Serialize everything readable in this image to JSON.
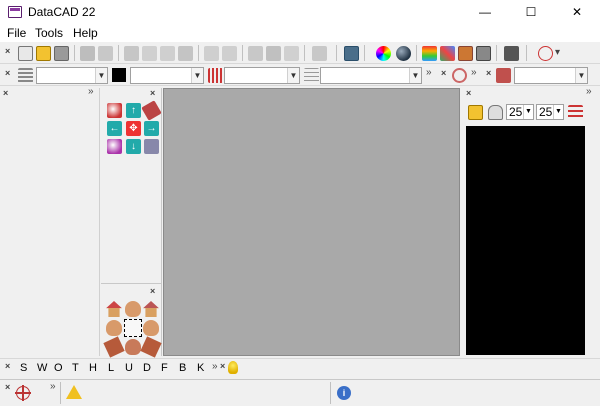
{
  "window": {
    "title": "DataCAD 22",
    "minimize_glyph": "—",
    "maximize_glyph": "☐",
    "close_glyph": "✕"
  },
  "menu": {
    "items": [
      "File",
      "Tools",
      "Help"
    ]
  },
  "toolbars": {
    "close_glyph": "×",
    "overflow_glyph": "»",
    "main_icons": [
      "new-file-icon",
      "open-folder-icon",
      "save-icon",
      "print-icon",
      "print-preview-icon",
      "paste-special-icon",
      "cut-icon",
      "copy-icon",
      "paste-icon",
      "undo-icon",
      "redo-icon",
      "layer-icon",
      "layer-set-icon",
      "snap-icon",
      "rotate-icon",
      "stack-icon",
      "color-wheel-icon",
      "sphere-icon",
      "rainbow-icon",
      "palette-icon",
      "hatch-icon",
      "fill-icon",
      "settings-icon",
      "symbol-icon"
    ],
    "layer_combo_value": "",
    "color_swatch": "#000000",
    "linetype_combo_value": "",
    "pattern_combo_value": "",
    "weight_combo_value": "",
    "material_combo_value": ""
  },
  "right_panel": {
    "spin1_value": "25",
    "spin2_value": "25"
  },
  "snap_bar": {
    "keys": [
      "S",
      "W",
      "O",
      "T",
      "H",
      "L",
      "U",
      "D",
      "F",
      "B",
      "K"
    ]
  },
  "status_bar": {
    "message": ""
  },
  "colors": {
    "drawing_area": "#a9a9a9",
    "preview_background": "#000000",
    "app_icon": "#8a3aa0"
  }
}
